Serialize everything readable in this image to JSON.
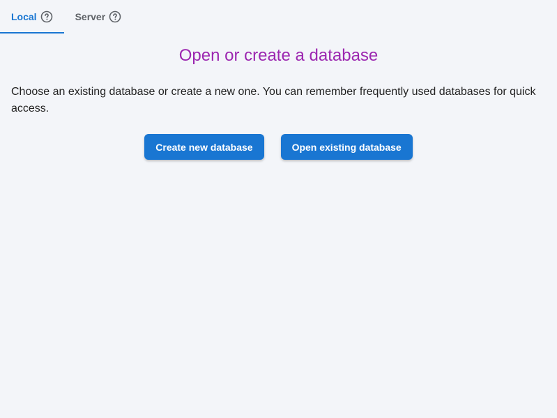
{
  "tabs": [
    {
      "label": "Local",
      "icon": "help-circle-icon",
      "active": true
    },
    {
      "label": "Server",
      "icon": "help-circle-icon",
      "active": false
    }
  ],
  "main": {
    "title": "Open or create a database",
    "description": "Choose an existing database or create a new one. You can remember frequently used databases for quick access.",
    "create_button_label": "Create new database",
    "open_button_label": "Open existing database"
  },
  "colors": {
    "background": "#f3f5f9",
    "accent": "#1976d2",
    "title": "#9c27b0"
  }
}
